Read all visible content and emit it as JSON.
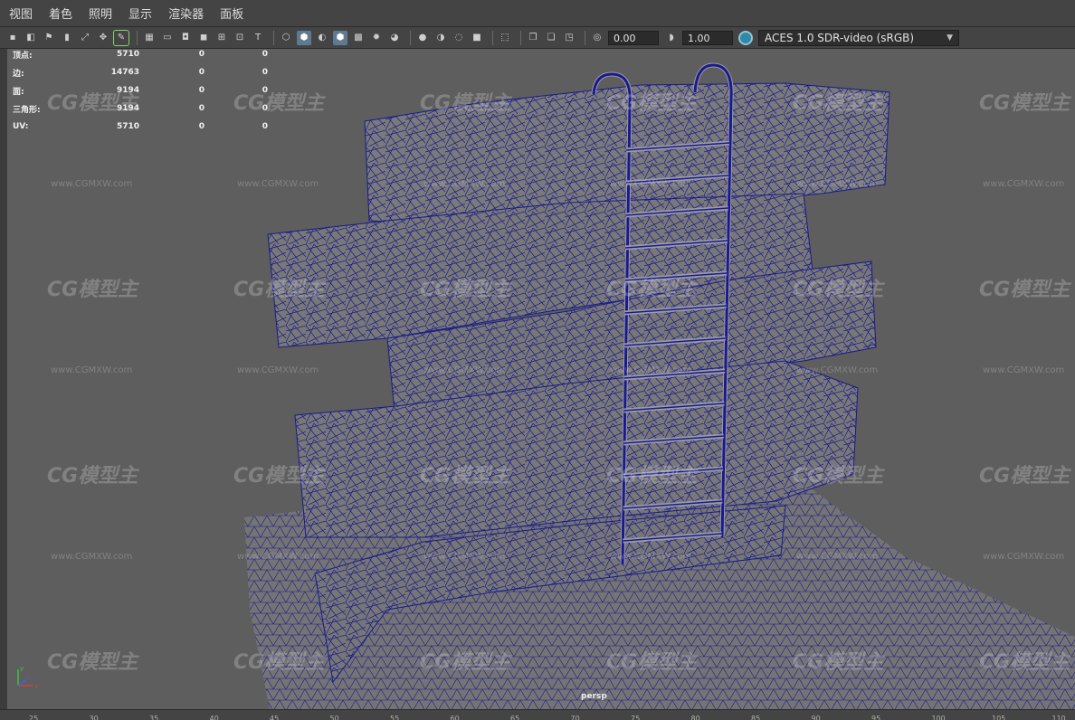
{
  "menu": [
    "视图",
    "着色",
    "照明",
    "显示",
    "渲染器",
    "面板"
  ],
  "toolbar": {
    "exposure": "0.00",
    "gamma": "1.00",
    "color_space": "ACES 1.0 SDR-video (sRGB)"
  },
  "stats": [
    {
      "label": "顶点:",
      "v1": "5710",
      "v2": "0",
      "v3": "0"
    },
    {
      "label": "边:",
      "v1": "14763",
      "v2": "0",
      "v3": "0"
    },
    {
      "label": "面:",
      "v1": "9194",
      "v2": "0",
      "v3": "0"
    },
    {
      "label": "三角形:",
      "v1": "9194",
      "v2": "0",
      "v3": "0"
    },
    {
      "label": "UV:",
      "v1": "5710",
      "v2": "0",
      "v3": "0"
    }
  ],
  "camera": "persp",
  "axis": {
    "x": "x",
    "y": "y",
    "z": "z"
  },
  "watermark": {
    "logo": "CG模型主",
    "url": "www.CGMXW.com"
  },
  "timeline_ticks": [
    "25",
    "30",
    "35",
    "40",
    "45",
    "50",
    "55",
    "60",
    "65",
    "70",
    "75",
    "80",
    "85",
    "90",
    "95",
    "100",
    "105",
    "110"
  ],
  "colors": {
    "viewport_bg": "#5e5e5e",
    "mesh_fill": "#7a7a7a",
    "wire": "#1a1a8c",
    "accent": "#5f7a8f"
  }
}
